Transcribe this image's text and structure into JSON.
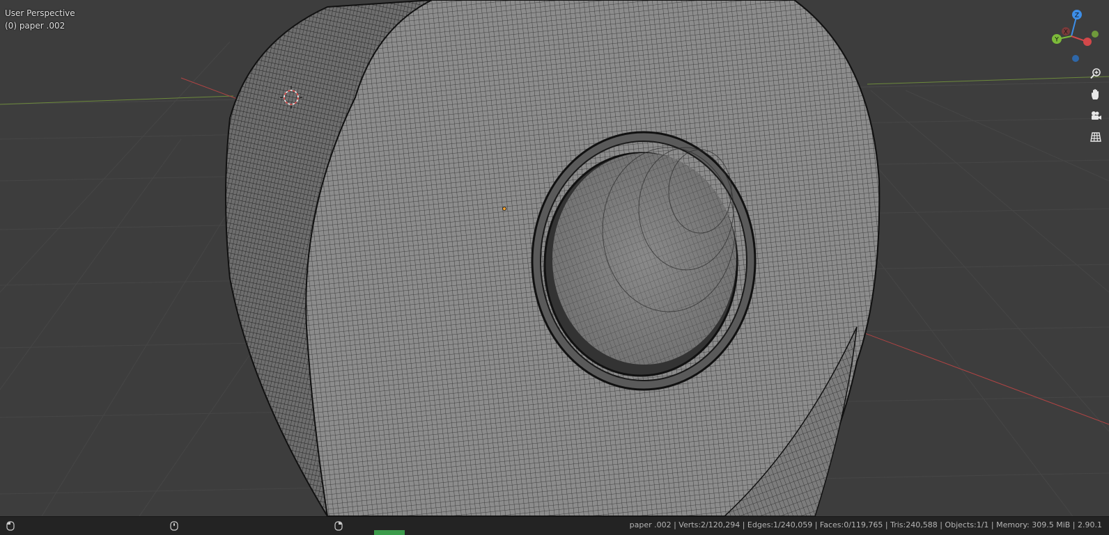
{
  "viewport": {
    "title": "User Perspective",
    "object_label": "(0) paper .002"
  },
  "navigation": {
    "gizmo_axes": [
      "Z",
      "Y",
      "X"
    ],
    "buttons": [
      "zoom-icon",
      "pan-hand-icon",
      "camera-icon",
      "grid-icon"
    ]
  },
  "statusbar": {
    "info": "paper .002 | Verts:2/120,294 | Edges:1/240,059 | Faces:0/119,765 | Tris:240,588 | Objects:1/1 | Memory: 309.5 MiB | 2.90.1",
    "mouse_hints": [
      "mouse-left-icon",
      "mouse-middle-icon",
      "mouse-right-icon"
    ]
  },
  "colors": {
    "background": "#3d3d3d",
    "x_axis": "#d2484a",
    "y_axis": "#7dbb3a",
    "z_axis": "#3d8ee8",
    "mesh_fill": "#8a8a8a",
    "statusbar": "#232323"
  }
}
